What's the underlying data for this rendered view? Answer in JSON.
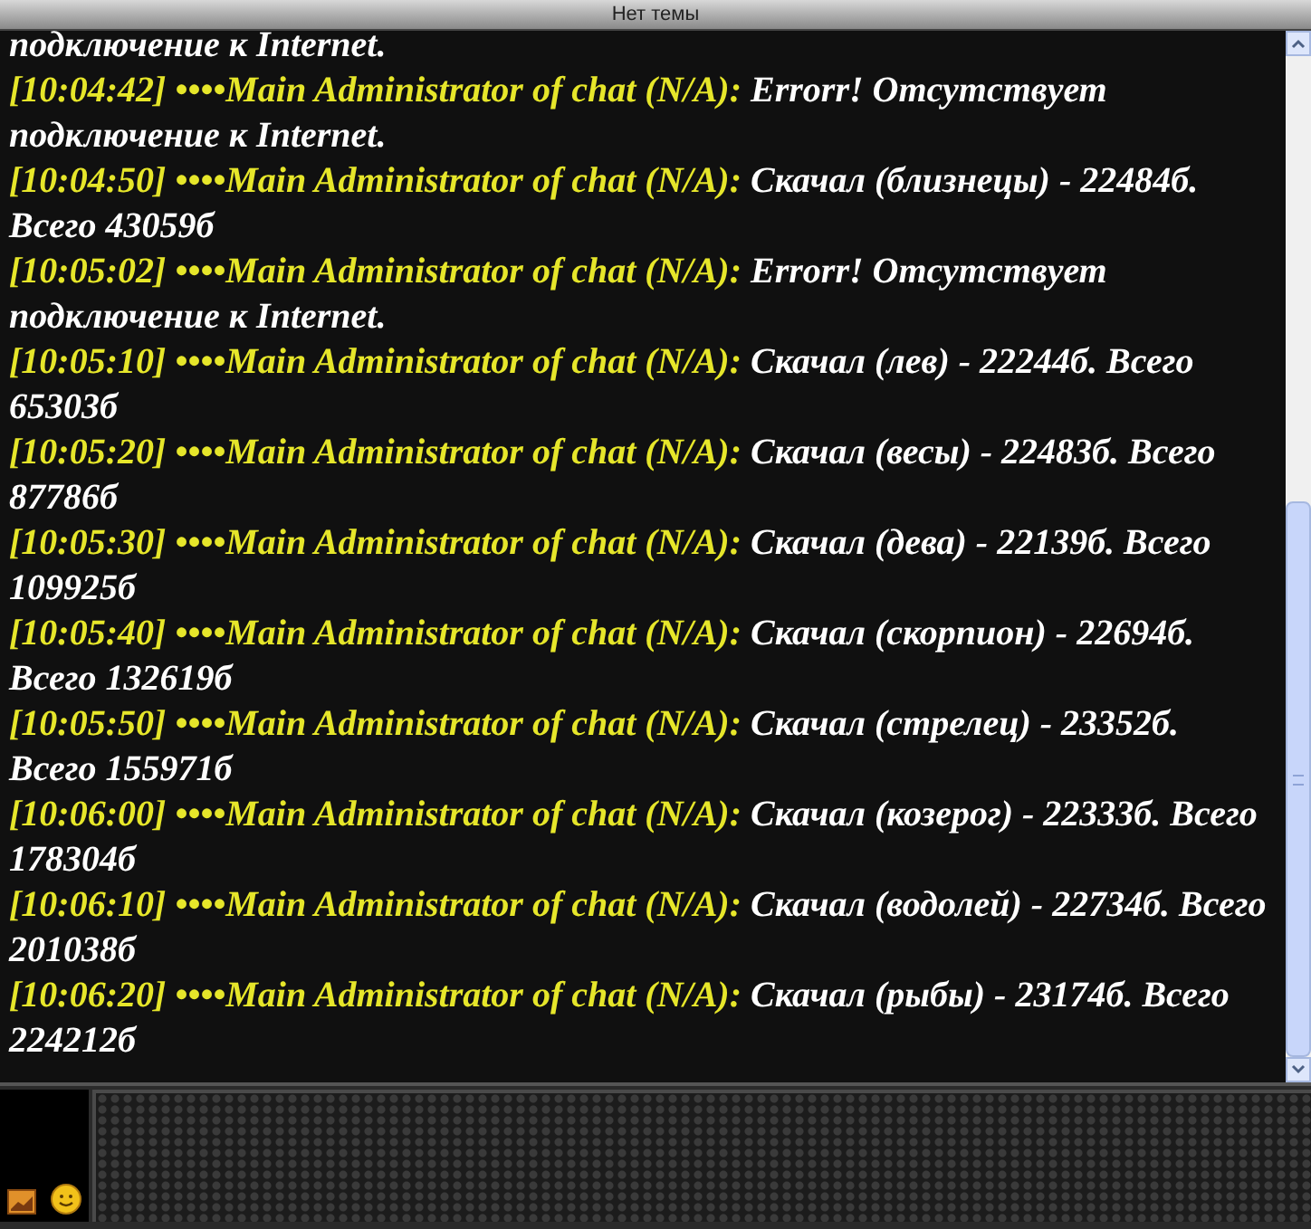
{
  "window": {
    "title": "Нет темы"
  },
  "chat": {
    "partial_line": "подключение к Internet.",
    "messages": [
      {
        "time": "[10:04:42]",
        "sender": "••••Main Administrator of chat (N/A):",
        "text": "Errorr! Отсутствует подключение к Internet."
      },
      {
        "time": "[10:04:50]",
        "sender": "••••Main Administrator of chat (N/A):",
        "text": "Скачал (близнецы) - 22484б. Всего 43059б"
      },
      {
        "time": "[10:05:02]",
        "sender": "••••Main Administrator of chat (N/A):",
        "text": "Errorr! Отсутствует подключение к Internet."
      },
      {
        "time": "[10:05:10]",
        "sender": "••••Main Administrator of chat (N/A):",
        "text": "Скачал (лев) - 22244б. Всего 65303б"
      },
      {
        "time": "[10:05:20]",
        "sender": "••••Main Administrator of chat (N/A):",
        "text": "Скачал (весы) - 22483б. Всего 87786б"
      },
      {
        "time": "[10:05:30]",
        "sender": "••••Main Administrator of chat (N/A):",
        "text": "Скачал (дева) - 22139б. Всего 109925б"
      },
      {
        "time": "[10:05:40]",
        "sender": "••••Main Administrator of chat (N/A):",
        "text": "Скачал (скорпион) - 22694б. Всего 132619б"
      },
      {
        "time": "[10:05:50]",
        "sender": "••••Main Administrator of chat (N/A):",
        "text": "Скачал (стрелец) - 23352б. Всего 155971б"
      },
      {
        "time": "[10:06:00]",
        "sender": "••••Main Administrator of chat (N/A):",
        "text": "Скачал (козерог) - 22333б. Всего 178304б"
      },
      {
        "time": "[10:06:10]",
        "sender": "••••Main Administrator of chat (N/A):",
        "text": "Скачал (водолей) - 22734б. Всего 201038б"
      },
      {
        "time": "[10:06:20]",
        "sender": "••••Main Administrator of chat (N/A):",
        "text": "Скачал (рыбы) - 23174б. Всего 224212б"
      }
    ]
  }
}
